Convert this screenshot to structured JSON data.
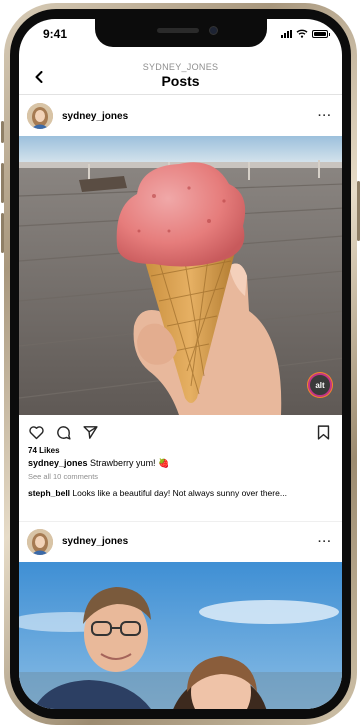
{
  "status_bar": {
    "time": "9:41"
  },
  "header": {
    "subtitle": "SYDNEY_JONES",
    "title": "Posts"
  },
  "posts": [
    {
      "username": "sydney_jones",
      "more": "···",
      "alt_badge": "alt",
      "likes": "74 Likes",
      "caption_user": "sydney_jones",
      "caption_text": "Strawberry yum! 🍓",
      "view_comments": "See all 10 comments",
      "comment_user": "steph_bell",
      "comment_text": "Looks like a beautiful day!  Not always sunny over there..."
    },
    {
      "username": "sydney_jones",
      "more": "···"
    }
  ],
  "colors": {
    "frame_gold": "#cfc2a9",
    "bezel": "#0c0c0c",
    "secondary_text": "#8e8e8e",
    "divider": "#e2e2e2",
    "alt_ring": "#c13584"
  },
  "icons": [
    "chevron-left-icon",
    "signal-icon",
    "wifi-icon",
    "battery-icon",
    "more-icon",
    "heart-icon",
    "comment-icon",
    "share-icon",
    "bookmark-icon"
  ]
}
